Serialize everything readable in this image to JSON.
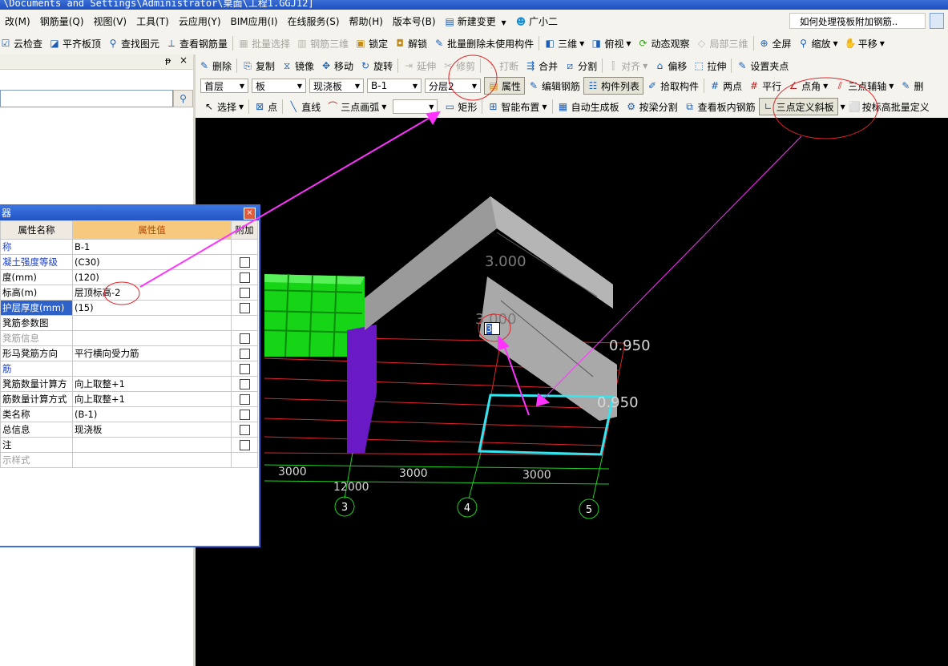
{
  "title_bar": "\\Documents and Settings\\Administrator\\桌面\\工程1.GGJ12]",
  "menu": {
    "items": [
      "改(M)",
      "钢筋量(Q)",
      "视图(V)",
      "工具(T)",
      "云应用(Y)",
      "BIM应用(I)",
      "在线服务(S)",
      "帮助(H)",
      "版本号(B)"
    ],
    "new_change": "新建变更",
    "assistant": "广小二",
    "help_question": "如何处理筏板附加钢筋.."
  },
  "toolbar1": {
    "cloud_check": "云检查",
    "flush_top": "平齐板顶",
    "find_element": "查找图元",
    "view_rebar": "查看钢筋量",
    "batch_select": "批量选择",
    "rebar_3d": "钢筋三维",
    "lock": "锁定",
    "unlock": "解锁",
    "batch_delete_unused": "批量删除未使用构件",
    "view_3d": "三维",
    "top_view": "俯视",
    "dynamic_view": "动态观察",
    "local_3d": "局部三维",
    "fullscreen": "全屏",
    "zoom": "缩放",
    "pan": "平移"
  },
  "toolbar2": {
    "delete": "删除",
    "copy": "复制",
    "mirror": "镜像",
    "move": "移动",
    "rotate": "旋转",
    "extend": "延伸",
    "trim": "修剪",
    "break": "打断",
    "merge": "合并",
    "split": "分割",
    "align": "对齐",
    "offset": "偏移",
    "stretch": "拉伸",
    "set_grip": "设置夹点"
  },
  "toolbar3": {
    "floor": "首层",
    "category": "板",
    "type": "现浇板",
    "component": "B-1",
    "layer": "分层2",
    "properties": "属性",
    "edit_rebar": "编辑钢筋",
    "component_list": "构件列表",
    "pick_component": "拾取构件",
    "two_points": "两点",
    "parallel": "平行",
    "point_angle": "点角",
    "three_point_axis": "三点辅轴",
    "delete_short": "删"
  },
  "toolbar4": {
    "select": "选择",
    "point": "点",
    "line": "直线",
    "arc3": "三点画弧",
    "rect": "矩形",
    "smart_layout": "智能布置",
    "auto_slab": "自动生成板",
    "split_by_beam": "按梁分割",
    "view_slab_rebar": "查看板内钢筋",
    "three_point_slope": "三点定义斜板",
    "batch_elev": "按标高批量定义"
  },
  "property_panel": {
    "caption": "器",
    "col_name": "属性名称",
    "col_value": "属性值",
    "col_extra": "附加",
    "rows": [
      {
        "name": "称",
        "value": "B-1",
        "style": "blue",
        "cb": false
      },
      {
        "name": "凝土强度等级",
        "value": "(C30)",
        "style": "blue",
        "cb": true
      },
      {
        "name": "度(mm)",
        "value": "(120)",
        "style": "",
        "cb": true
      },
      {
        "name": "标高(m)",
        "value": "层顶标高-2",
        "style": "",
        "cb": true
      },
      {
        "name": "护层厚度(mm)",
        "value": "(15)",
        "style": "hl",
        "cb": true
      },
      {
        "name": "凳筋参数图",
        "value": "",
        "style": "",
        "cb": false
      },
      {
        "name": "凳筋信息",
        "value": "",
        "style": "gray",
        "cb": true
      },
      {
        "name": "形马凳筋方向",
        "value": "平行横向受力筋",
        "style": "",
        "cb": true
      },
      {
        "name": "筋",
        "value": "",
        "style": "blue",
        "cb": true
      },
      {
        "name": "凳筋数量计算方",
        "value": "向上取整+1",
        "style": "",
        "cb": true
      },
      {
        "name": "筋数量计算方式",
        "value": "向上取整+1",
        "style": "",
        "cb": true
      },
      {
        "name": "类名称",
        "value": "(B-1)",
        "style": "",
        "cb": true
      },
      {
        "name": "总信息",
        "value": "现浇板",
        "style": "",
        "cb": true
      },
      {
        "name": "注",
        "value": "",
        "style": "",
        "cb": true
      },
      {
        "name": "示样式",
        "value": "",
        "style": "gray",
        "cb": false
      }
    ]
  },
  "canvas": {
    "slab_label_top": "3.000",
    "slab_label_mid": "3.000",
    "elev_right_1": "0.950",
    "elev_right_2": "0.950",
    "input_value": "3",
    "dim_1": "3000",
    "dim_2": "3000",
    "dim_3": "3000",
    "dim_total": "12000",
    "axis_3": "3",
    "axis_4": "4",
    "axis_5": "5"
  },
  "colors": {
    "annotation": "#ff33ff",
    "circle": "#e0242a",
    "selection": "#33e5ee",
    "grid": "#e0242a",
    "axis": "#1fd11f"
  }
}
